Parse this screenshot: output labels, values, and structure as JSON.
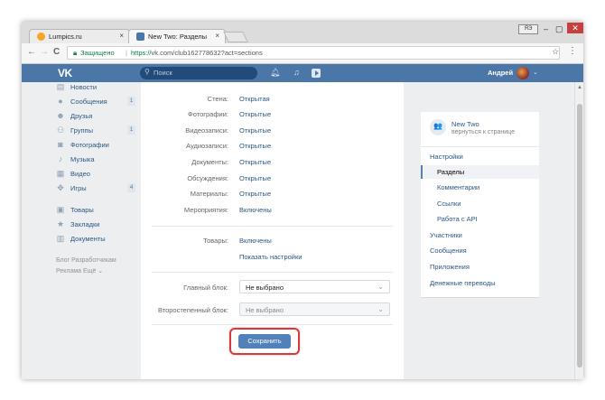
{
  "browser": {
    "tabs": [
      {
        "title": "Lumpics.ru",
        "close": "×"
      },
      {
        "title": "New Two: Разделы",
        "close": "×"
      }
    ],
    "user_badge": "ЯЭ",
    "window": {
      "minimize": "–",
      "maximize": "▢",
      "close": "✕"
    },
    "nav": {
      "back": "←",
      "forward": "→",
      "reload": "C"
    },
    "address": {
      "secure_label": "Защищено",
      "separator": "|",
      "scheme": "https://",
      "url": "vk.com/club162778632?act=sections"
    },
    "star": "☆",
    "menu": "⋮"
  },
  "vk_header": {
    "logo": "VK",
    "search_placeholder": "Поиск",
    "user_name": "Андрей"
  },
  "left_nav": [
    {
      "label": "Новости",
      "icon": "news-icon",
      "count": ""
    },
    {
      "label": "Сообщения",
      "icon": "messages-icon",
      "count": "1"
    },
    {
      "label": "Друзья",
      "icon": "friends-icon",
      "count": ""
    },
    {
      "label": "Группы",
      "icon": "groups-icon",
      "count": "1"
    },
    {
      "label": "Фотографии",
      "icon": "photos-icon",
      "count": ""
    },
    {
      "label": "Музыка",
      "icon": "music-icon",
      "count": ""
    },
    {
      "label": "Видео",
      "icon": "video-icon",
      "count": ""
    },
    {
      "label": "Игры",
      "icon": "games-icon",
      "count": "4"
    },
    {
      "label": "Товары",
      "icon": "goods-icon",
      "count": ""
    },
    {
      "label": "Закладки",
      "icon": "bookmarks-icon",
      "count": ""
    },
    {
      "label": "Документы",
      "icon": "documents-icon",
      "count": ""
    }
  ],
  "left_footer": {
    "line1": "Блог  Разработчикам",
    "line2": "Реклама  Ещё ⌄"
  },
  "sections": [
    {
      "key": "Стена:",
      "value": "Открытая"
    },
    {
      "key": "Фотографии:",
      "value": "Открытые"
    },
    {
      "key": "Видеозаписи:",
      "value": "Открытые"
    },
    {
      "key": "Аудиозаписи:",
      "value": "Открытые"
    },
    {
      "key": "Документы:",
      "value": "Открытые"
    },
    {
      "key": "Обсуждения:",
      "value": "Открытые"
    },
    {
      "key": "Материалы:",
      "value": "Открытые"
    },
    {
      "key": "Мероприятия:",
      "value": "Включены"
    }
  ],
  "goods": {
    "key": "Товары:",
    "value": "Включены",
    "settings_link": "Показать настройки"
  },
  "blocks": {
    "main": {
      "label": "Главный блок:",
      "value": "Не выбрано"
    },
    "secondary": {
      "label": "Второстепенный блок:",
      "value": "Не выбрано"
    }
  },
  "save_label": "Сохранить",
  "right_menu": {
    "club_name": "New Two",
    "back_label": "вернуться к странице",
    "items": [
      {
        "label": "Настройки",
        "indent": false,
        "selected": false
      },
      {
        "label": "Разделы",
        "indent": true,
        "selected": true
      },
      {
        "label": "Комментарии",
        "indent": true,
        "selected": false
      },
      {
        "label": "Ссылки",
        "indent": true,
        "selected": false
      },
      {
        "label": "Работа с API",
        "indent": true,
        "selected": false
      },
      {
        "label": "Участники",
        "indent": false,
        "selected": false
      },
      {
        "label": "Сообщения",
        "indent": false,
        "selected": false
      },
      {
        "label": "Приложения",
        "indent": false,
        "selected": false
      },
      {
        "label": "Денежные переводы",
        "indent": false,
        "selected": false
      }
    ]
  },
  "colors": {
    "vk_blue": "#4a76a8",
    "link": "#2a5885",
    "button": "#5181b8",
    "highlight": "#d63a3a"
  }
}
